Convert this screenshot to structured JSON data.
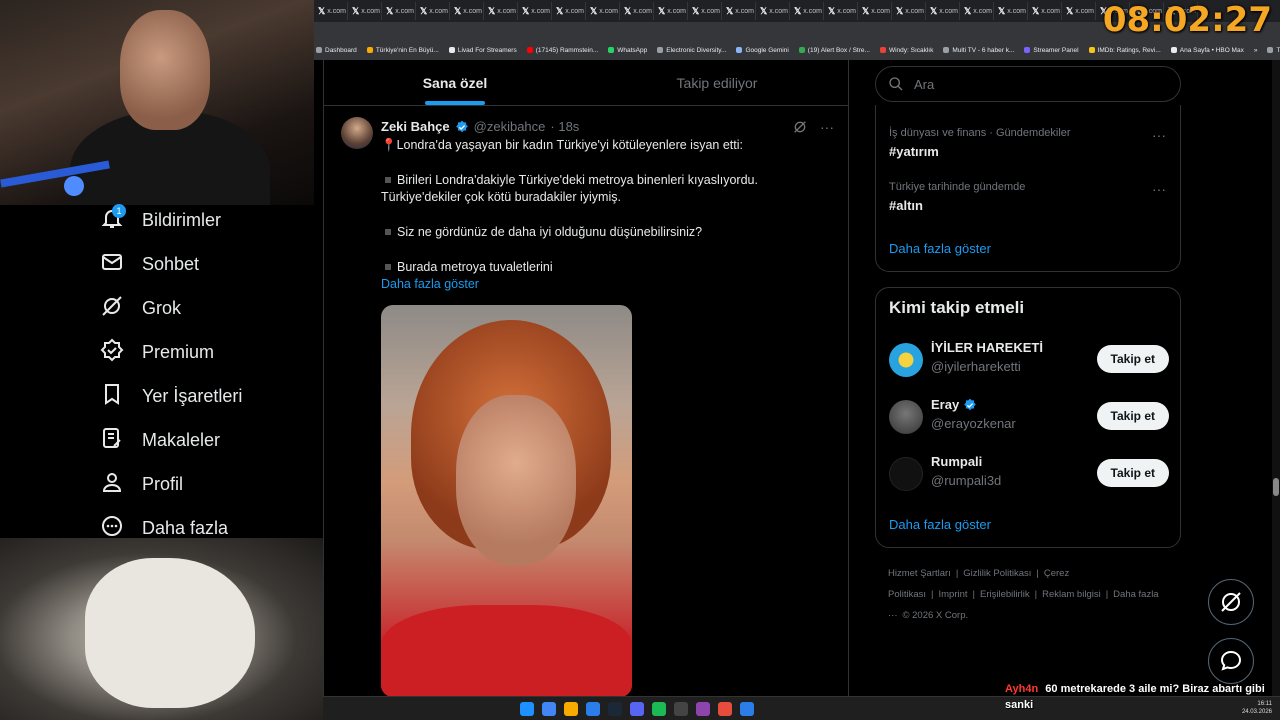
{
  "browser": {
    "tab_label": "x.com",
    "tab_count": 26,
    "bookmarks": [
      {
        "label": "Dashboard",
        "color": "#9aa0a6"
      },
      {
        "label": "Türkiye'nin En Büyü...",
        "color": "#f9ab00"
      },
      {
        "label": "Livad For Streamers",
        "color": "#e8eaed"
      },
      {
        "label": "(17145) Rammstein...",
        "color": "#ff0000"
      },
      {
        "label": "WhatsApp",
        "color": "#25d366"
      },
      {
        "label": "Electronic Diversity...",
        "color": "#9aa0a6"
      },
      {
        "label": "Google Gemini",
        "color": "#8ab4f8"
      },
      {
        "label": "(19) Alert Box / Stre...",
        "color": "#34a853"
      },
      {
        "label": "Windy: Sıcaklık",
        "color": "#ea4335"
      },
      {
        "label": "Multi TV - 6 haber k...",
        "color": "#9aa0a6"
      },
      {
        "label": "Streamer Panel",
        "color": "#7b61ff"
      },
      {
        "label": "IMDb: Ratings, Revi...",
        "color": "#f5c518"
      },
      {
        "label": "Ana Sayfa • HBO Max",
        "color": "#e8eaed"
      },
      {
        "label": "»",
        "color": ""
      },
      {
        "label": "Tüm Yer İşaretleri",
        "color": "#9aa0a6"
      }
    ]
  },
  "overlay": {
    "clock": "08:02:27"
  },
  "nav": {
    "items": [
      {
        "label": "Bildirimler",
        "icon": "bell-icon",
        "badge": "1"
      },
      {
        "label": "Sohbet",
        "icon": "mail-icon"
      },
      {
        "label": "Grok",
        "icon": "grok-icon"
      },
      {
        "label": "Premium",
        "icon": "verified-badge-icon"
      },
      {
        "label": "Yer İşaretleri",
        "icon": "bookmark-icon"
      },
      {
        "label": "Makaleler",
        "icon": "article-icon"
      },
      {
        "label": "Profil",
        "icon": "person-icon"
      },
      {
        "label": "Daha fazla",
        "icon": "more-circle-icon"
      }
    ]
  },
  "feed": {
    "tabs": [
      {
        "label": "Sana özel",
        "active": true
      },
      {
        "label": "Takip ediliyor",
        "active": false
      }
    ],
    "tweet": {
      "name": "Zeki Bahçe",
      "handle": "@zekibahce",
      "time": "· 18s",
      "lines": [
        "📍Londra'da yaşayan bir kadın Türkiye'yi kötüleyenlere isyan etti:",
        "Birileri Londra'dakiyle Türkiye'deki metroya binenleri kıyaslıyordu. Türkiye'dekiler çok kötü buradakiler iyiymiş.",
        "Siz ne gördünüz de daha iyi olduğunu düşünebilirsiniz?",
        "Burada metroya tuvaletlerini"
      ],
      "show_more": "Daha fazla göster"
    }
  },
  "sidebar": {
    "search_placeholder": "Ara",
    "trends": [
      {
        "meta": "İş dünyası ve finans · Gündemdekiler",
        "tag": "#yatırım"
      },
      {
        "meta": "Türkiye tarihinde gündemde",
        "tag": "#altın"
      }
    ],
    "trends_more": "Daha fazla göster",
    "who_title": "Kimi takip etmeli",
    "suggestions": [
      {
        "name": "İYİLER HAREKETİ",
        "handle": "@iyilerhareketti",
        "verified": false,
        "color": "#29a3e0"
      },
      {
        "name": "Eray",
        "handle": "@erayozkenar",
        "verified": true,
        "color": "#4a4a4a"
      },
      {
        "name": "Rumpali",
        "handle": "@rumpali3d",
        "verified": false,
        "color": "#111111"
      }
    ],
    "follow_label": "Takip et",
    "who_more": "Daha fazla göster",
    "footer": [
      "Hizmet Şartları",
      "|",
      "Gizlilik Politikası",
      "|",
      "Çerez Politikası",
      "|",
      "Imprint",
      "|",
      "Erişilebilirlik",
      "|",
      "Reklam bilgisi",
      "|",
      "Daha fazla ···",
      "© 2026 X Corp."
    ]
  },
  "chat": {
    "user": "Ayh4n",
    "message": "60 metrekarede 3 aile mi? Biraz abartı gibi sanki"
  },
  "taskbar": {
    "time": "16:11",
    "date": "24.03.2026"
  },
  "colors": {
    "accent": "#1d9bf0",
    "clock": "#f5a623",
    "chat_user": "#ff3b30"
  }
}
